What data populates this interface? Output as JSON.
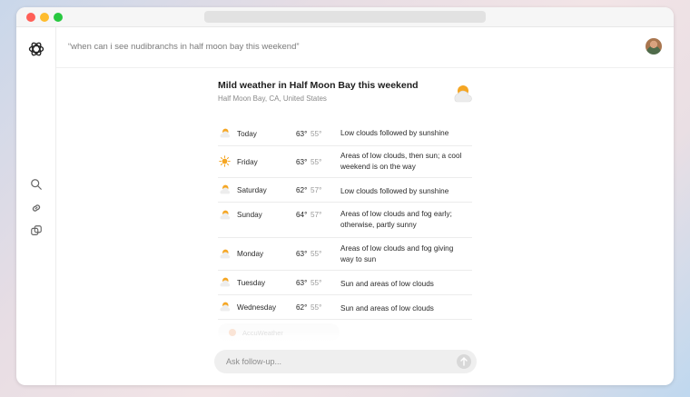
{
  "window": {
    "url_bar": ""
  },
  "query": {
    "text": "“when can i see nudibranchs in half moon bay this weekend”"
  },
  "header": {
    "title": "Mild weather in Half Moon Bay this weekend",
    "location": "Half Moon Bay, CA, United States",
    "icon": "partly-cloudy-icon"
  },
  "forecast": [
    {
      "day": "Today",
      "hi": "63°",
      "lo": "55°",
      "desc": "Low clouds followed by sunshine",
      "icon": "partly-cloudy-icon"
    },
    {
      "day": "Friday",
      "hi": "63°",
      "lo": "55°",
      "desc": "Areas of low clouds, then sun; a cool weekend is on the way",
      "icon": "sun-icon"
    },
    {
      "day": "Saturday",
      "hi": "62°",
      "lo": "57°",
      "desc": "Low clouds followed by sunshine",
      "icon": "partly-cloudy-icon"
    },
    {
      "day": "Sunday",
      "hi": "64°",
      "lo": "57°",
      "desc": "Areas of low clouds and fog early; otherwise, partly sunny",
      "icon": "partly-cloudy-icon"
    },
    {
      "day": "Monday",
      "hi": "63°",
      "lo": "55°",
      "desc": "Areas of low clouds and fog giving way to sun",
      "icon": "partly-cloudy-icon"
    },
    {
      "day": "Tuesday",
      "hi": "63°",
      "lo": "55°",
      "desc": "Sun and areas of low clouds",
      "icon": "partly-cloudy-icon"
    },
    {
      "day": "Wednesday",
      "hi": "62°",
      "lo": "55°",
      "desc": "Sun and areas of low clouds",
      "icon": "partly-cloudy-icon"
    }
  ],
  "faded_source": {
    "label": "AccuWeather"
  },
  "followup": {
    "placeholder": "Ask follow-up..."
  },
  "colors": {
    "sun": "#f5a623",
    "cloud": "#e9e9e9",
    "accent": "#f0f0f0"
  }
}
